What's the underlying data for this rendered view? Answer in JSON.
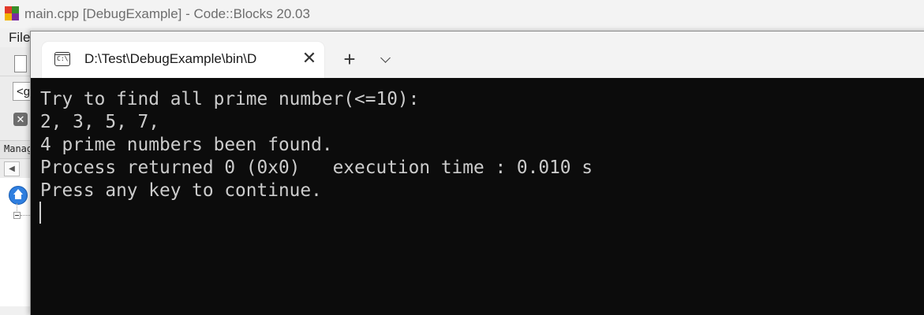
{
  "codeblocks": {
    "window_title": "main.cpp [DebugExample] - Code::Blocks 20.03",
    "menu_file": "File",
    "combo_value": "<g",
    "management_label": "Manag"
  },
  "terminal": {
    "tab_title": "D:\\Test\\DebugExample\\bin\\D",
    "tab_icon": "cmd-icon",
    "close_glyph": "✕",
    "new_tab_glyph": "+",
    "lines": [
      "Try to find all prime number(<=10):",
      "2, 3, 5, 7,",
      "4 prime numbers been found.",
      "Process returned 0 (0x0)   execution time : 0.010 s",
      "Press any key to continue."
    ]
  },
  "colors": {
    "terminal_bg": "#0c0c0c",
    "terminal_fg": "#cccccc",
    "tabbar_bg": "#f3f3f3"
  }
}
